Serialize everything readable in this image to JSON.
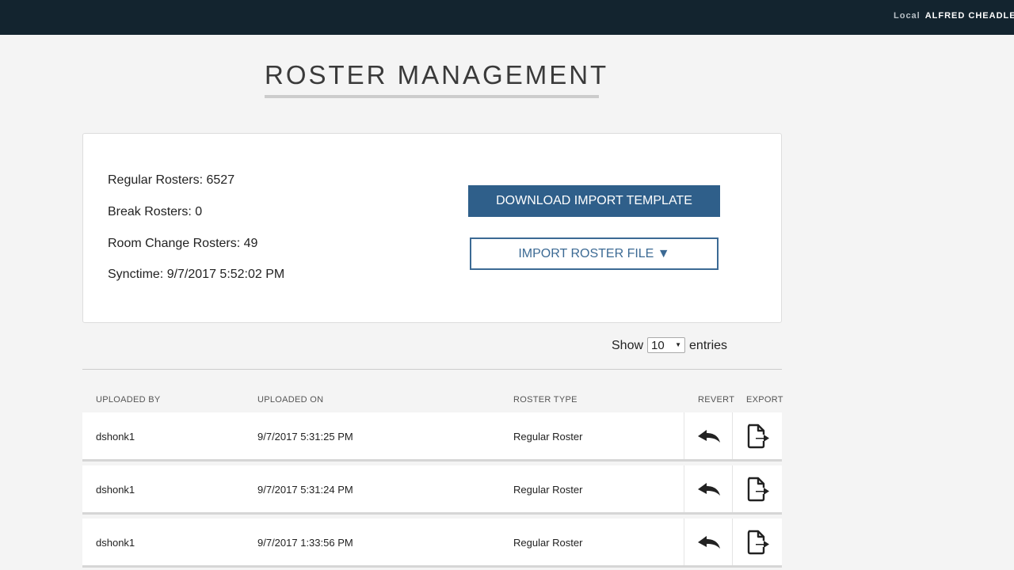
{
  "header": {
    "location": "Local",
    "user_name": "ALFRED CHEADLE"
  },
  "page": {
    "title": "ROSTER MANAGEMENT"
  },
  "summary": {
    "regular_rosters": "Regular Rosters: 6527",
    "break_rosters": "Break Rosters: 0",
    "room_change_rosters": "Room Change Rosters: 49",
    "synctime": "Synctime: 9/7/2017 5:52:02 PM",
    "download_button": "DOWNLOAD IMPORT TEMPLATE",
    "import_button": "IMPORT ROSTER FILE ▼"
  },
  "table_controls": {
    "show_label": "Show",
    "entries_value": "10",
    "entries_label": "entries"
  },
  "table": {
    "columns": [
      "UPLOADED BY",
      "UPLOADED ON",
      "ROSTER TYPE",
      "REVERT",
      "EXPORT"
    ],
    "rows": [
      {
        "uploaded_by": "dshonk1",
        "uploaded_on": "9/7/2017 5:31:25 PM",
        "roster_type": "Regular Roster"
      },
      {
        "uploaded_by": "dshonk1",
        "uploaded_on": "9/7/2017 5:31:24 PM",
        "roster_type": "Regular Roster"
      },
      {
        "uploaded_by": "dshonk1",
        "uploaded_on": "9/7/2017 1:33:56 PM",
        "roster_type": "Regular Roster"
      }
    ]
  },
  "icons": {
    "revert": "undo-arrow-icon",
    "export": "file-export-icon",
    "dropdown": "dropdown-arrow-icon"
  },
  "colors": {
    "topbar": "#13242f",
    "primary": "#2f5f8a",
    "outline": "#3c6a94",
    "background": "#f4f4f4"
  }
}
